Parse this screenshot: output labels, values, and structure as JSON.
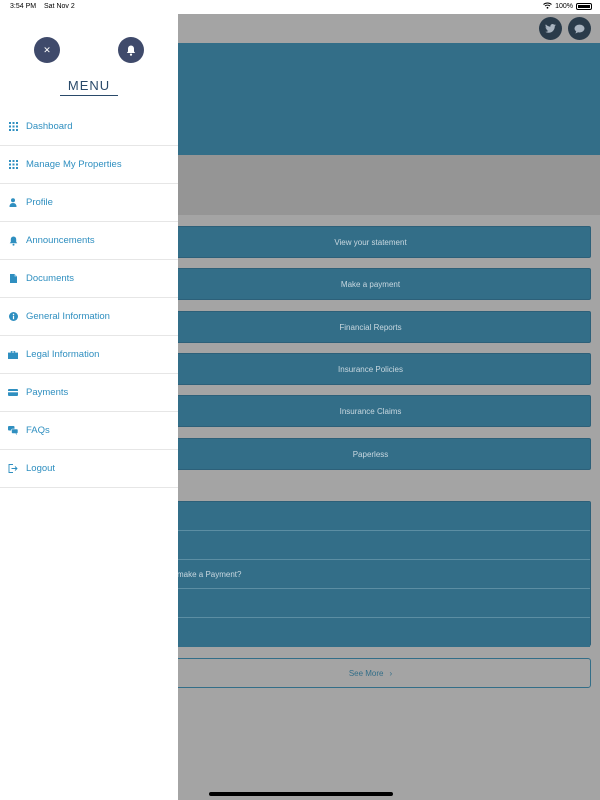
{
  "status_bar": {
    "time": "3:54 PM",
    "date": "Sat Nov 2",
    "battery": "100%"
  },
  "drawer": {
    "title": "MENU",
    "items": [
      {
        "label": "Dashboard",
        "icon": "grid-icon"
      },
      {
        "label": "Manage My Properties",
        "icon": "grid-icon"
      },
      {
        "label": "Profile",
        "icon": "person-icon"
      },
      {
        "label": "Announcements",
        "icon": "bell-icon"
      },
      {
        "label": "Documents",
        "icon": "document-icon"
      },
      {
        "label": "General Information",
        "icon": "info-icon"
      },
      {
        "label": "Legal Information",
        "icon": "briefcase-icon"
      },
      {
        "label": "Payments",
        "icon": "credit-card-icon"
      },
      {
        "label": "FAQs",
        "icon": "faq-chat-icon"
      },
      {
        "label": "Logout",
        "icon": "logout-icon"
      }
    ]
  },
  "main": {
    "actions": [
      "View your statement",
      "Make a payment",
      "Financial Reports",
      "Insurance Policies",
      "Insurance Claims",
      "Paperless"
    ],
    "faq_rows": [
      "",
      "",
      "l make a Payment?",
      "",
      ""
    ],
    "see_more": "See More",
    "see_more_chevron": "›"
  },
  "colors": {
    "banner": "#336e88",
    "drawer_link": "#2f8fc0",
    "circle_button": "#3f4a6b"
  }
}
